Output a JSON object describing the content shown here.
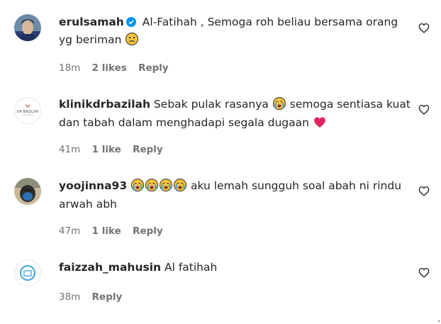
{
  "comments": [
    {
      "username": "erulsamah",
      "verified": true,
      "text_1": "Al-Fatihah , Semoga roh beliau bersama orang yg beriman",
      "text_2": "",
      "time": "18m",
      "likes": "2 likes",
      "reply": "Reply"
    },
    {
      "username": "klinikdrbazilah",
      "verified": false,
      "text_1": "Sebak pulak rasanya",
      "text_2": "semoga sentiasa kuat dan tabah dalam menghadapi segala dugaan",
      "avatar_text": "DR BAZILAH",
      "time": "41m",
      "likes": "1 like",
      "reply": "Reply"
    },
    {
      "username": "yoojinna93",
      "verified": false,
      "text_1": "",
      "text_2": "aku lemah sungguh soal abah ni rindu arwah abh",
      "time": "47m",
      "likes": "1 like",
      "reply": "Reply"
    },
    {
      "username": "faizzah_mahusin",
      "verified": false,
      "text_1": "Al fatihah",
      "text_2": "",
      "time": "38m",
      "likes": "",
      "reply": "Reply"
    }
  ],
  "icons": {
    "like": "heart-outline-icon",
    "verified": "verified-badge-icon",
    "sad_face": "frowning-face-emoji",
    "crying_face": "loudly-crying-face-emoji",
    "red_heart": "red-heart-emoji"
  },
  "colors": {
    "text": "#262626",
    "meta": "#737373",
    "verified": "#0095f6",
    "heart_emoji": "#e0245e"
  }
}
